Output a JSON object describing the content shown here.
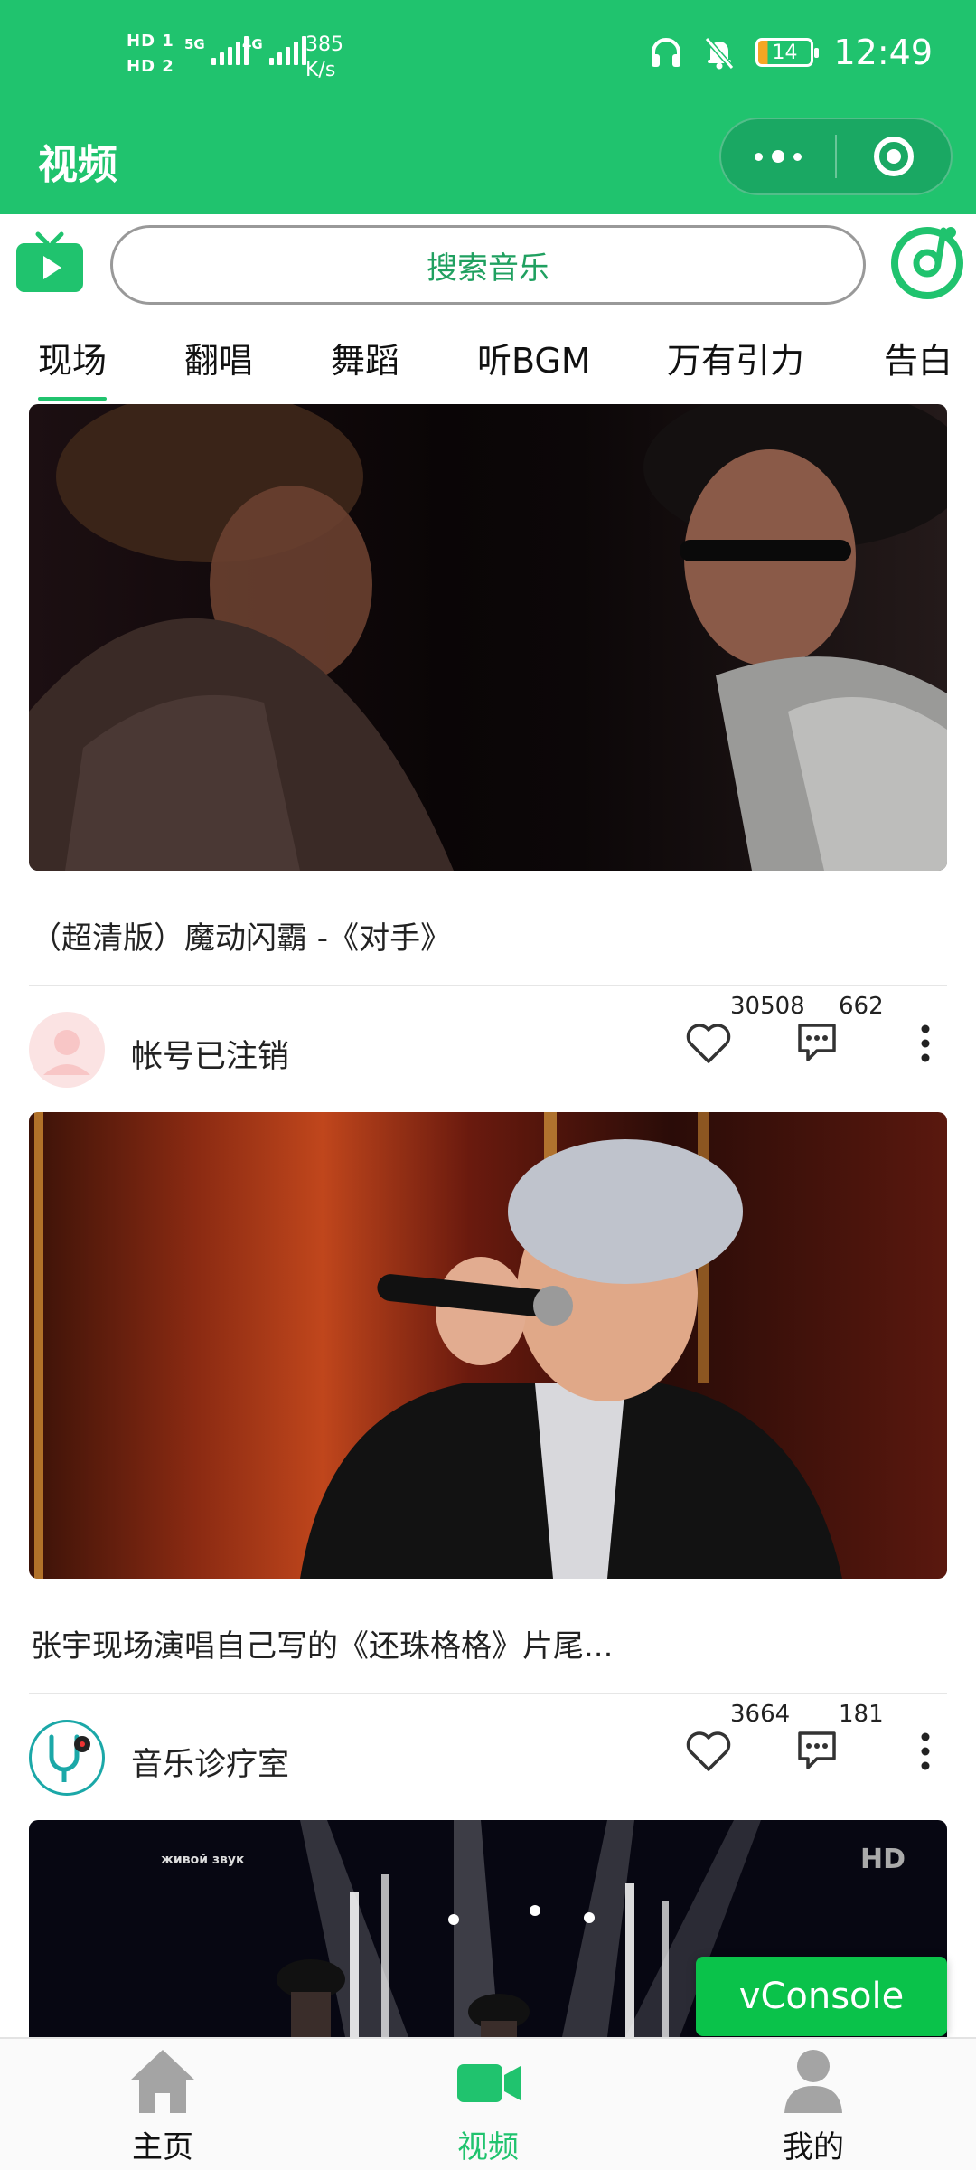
{
  "status_bar": {
    "sim1": "HD 1",
    "sim2": "HD 2",
    "net1": "5G",
    "net2": "4G",
    "speed_value": "385",
    "speed_unit": "K/s",
    "battery": "14",
    "time": "12:49",
    "icons": [
      "headphones-icon",
      "mute-bell-icon",
      "battery-icon"
    ]
  },
  "header": {
    "title": "视频",
    "more_icon": "more-dots-icon",
    "close_icon": "target-icon"
  },
  "search": {
    "placeholder": "搜索音乐",
    "left_icon": "tv-play-icon",
    "right_icon": "music-disc-icon"
  },
  "tabs": [
    {
      "label": "现场",
      "active": true
    },
    {
      "label": "翻唱",
      "active": false
    },
    {
      "label": "舞蹈",
      "active": false
    },
    {
      "label": "听BGM",
      "active": false
    },
    {
      "label": "万有引力",
      "active": false
    },
    {
      "label": "告白",
      "active": false
    }
  ],
  "videos": [
    {
      "title": "（超清版）魔动闪霸 -《对手》",
      "author": "帐号已注销",
      "likes": "30508",
      "comments": "662"
    },
    {
      "title": "张宇现场演唱自己写的《还珠格格》片尾...",
      "author": "音乐诊疗室",
      "likes": "3664",
      "comments": "181"
    },
    {
      "overlay_left": "живой звук",
      "overlay_right": "HD"
    }
  ],
  "vconsole": {
    "label": "vConsole"
  },
  "bottom_nav": [
    {
      "label": "主页",
      "icon": "home-icon",
      "active": false
    },
    {
      "label": "视频",
      "icon": "video-camera-icon",
      "active": true
    },
    {
      "label": "我的",
      "icon": "user-icon",
      "active": false
    }
  ],
  "colors": {
    "brand_green": "#20c36e",
    "tab_underline": "#20c36e",
    "vconsole_green": "#0ac24a",
    "inactive_nav": "#9a9a9a"
  }
}
